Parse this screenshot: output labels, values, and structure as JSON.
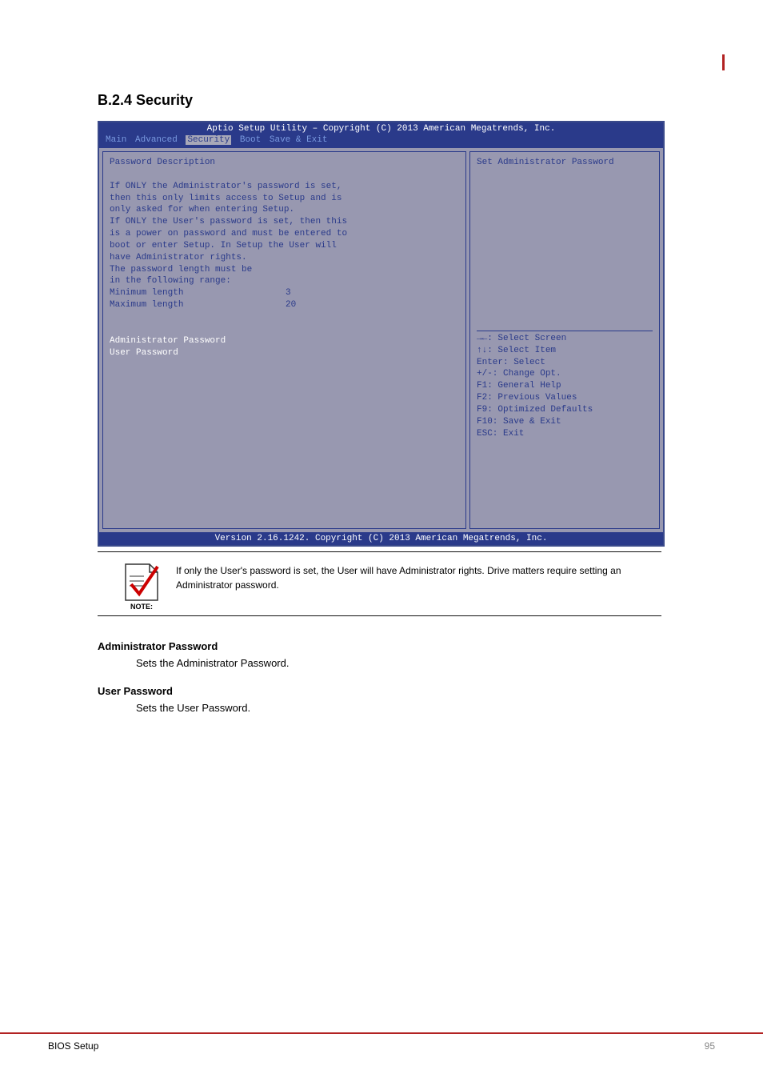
{
  "section_title": "B.2.4 Security",
  "bios": {
    "header": "Aptio Setup Utility – Copyright (C) 2013 American Megatrends, Inc.",
    "tabs": {
      "main": "Main",
      "advanced": "Advanced",
      "security": "Security",
      "boot": "Boot",
      "save_exit": "Save & Exit"
    },
    "left": {
      "title": "Password Description",
      "lines": [
        "If ONLY the Administrator's password is set,",
        "then this only limits access to Setup and is",
        "only asked for when entering Setup.",
        "If ONLY the User's password is set, then this",
        "is a power on password and must be entered to",
        "boot or enter Setup. In Setup the User will",
        "have Administrator rights.",
        "The password length must be",
        "in the following range:"
      ],
      "min_label": "Minimum length",
      "min_value": "3",
      "max_label": "Maximum length",
      "max_value": "20",
      "admin_pw": "Administrator Password",
      "user_pw": "User Password"
    },
    "right": {
      "help": "Set Administrator Password",
      "keys": [
        "→←: Select Screen",
        "↑↓: Select Item",
        "Enter: Select",
        "+/-: Change Opt.",
        "F1: General Help",
        "F2: Previous Values",
        "F9: Optimized Defaults",
        "F10: Save & Exit",
        "ESC: Exit"
      ]
    },
    "footer": "Version 2.16.1242. Copyright (C) 2013 American Megatrends, Inc."
  },
  "note": {
    "label": "NOTE:",
    "text": "If only the User's password is set, the User will have Administrator rights. Drive matters require setting an Administrator password."
  },
  "items": {
    "admin_title": "Administrator Password",
    "admin_desc": "Sets the Administrator Password.",
    "user_title": "User Password",
    "user_desc": "Sets the User Password."
  },
  "footer": {
    "left": "BIOS Setup",
    "right": "95"
  }
}
